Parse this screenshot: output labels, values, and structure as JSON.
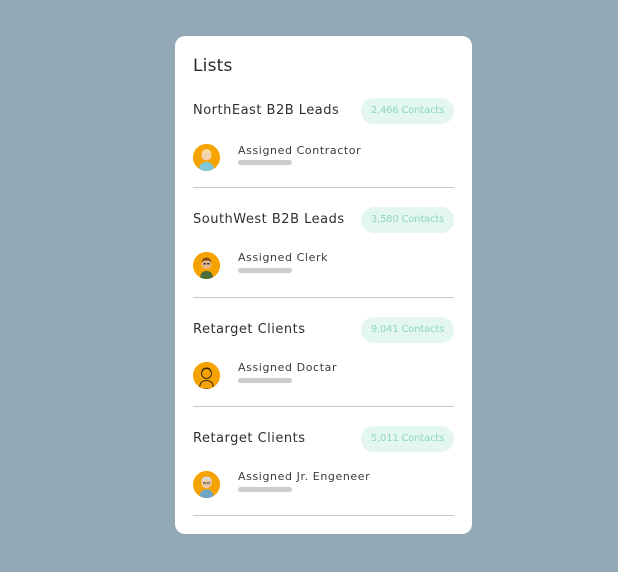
{
  "card": {
    "title": "Lists"
  },
  "lists": [
    {
      "name": "NorthEast B2B Leads",
      "contacts": "2,466 Contacts",
      "assignee": "Assigned Contractor",
      "avatar_icon": "contractor-avatar-icon"
    },
    {
      "name": "SouthWest B2B Leads",
      "contacts": "3,580 Contacts",
      "assignee": "Assigned Clerk",
      "avatar_icon": "clerk-avatar-icon"
    },
    {
      "name": "Retarget Clients",
      "contacts": "9,041 Contacts",
      "assignee": "Assigned Doctar",
      "avatar_icon": "doctor-avatar-icon"
    },
    {
      "name": "Retarget Clients",
      "contacts": "5,011 Contacts",
      "assignee": "Assigned Jr. Engeneer",
      "avatar_icon": "engineer-avatar-icon"
    }
  ],
  "colors": {
    "background": "#93a8b5",
    "card": "#ffffff",
    "badge_bg": "#e3f7ef",
    "badge_text": "#8fd7bb",
    "avatar_bg": "#f5a300",
    "divider": "#c8c8c8",
    "progress_track": "#cccccc"
  }
}
